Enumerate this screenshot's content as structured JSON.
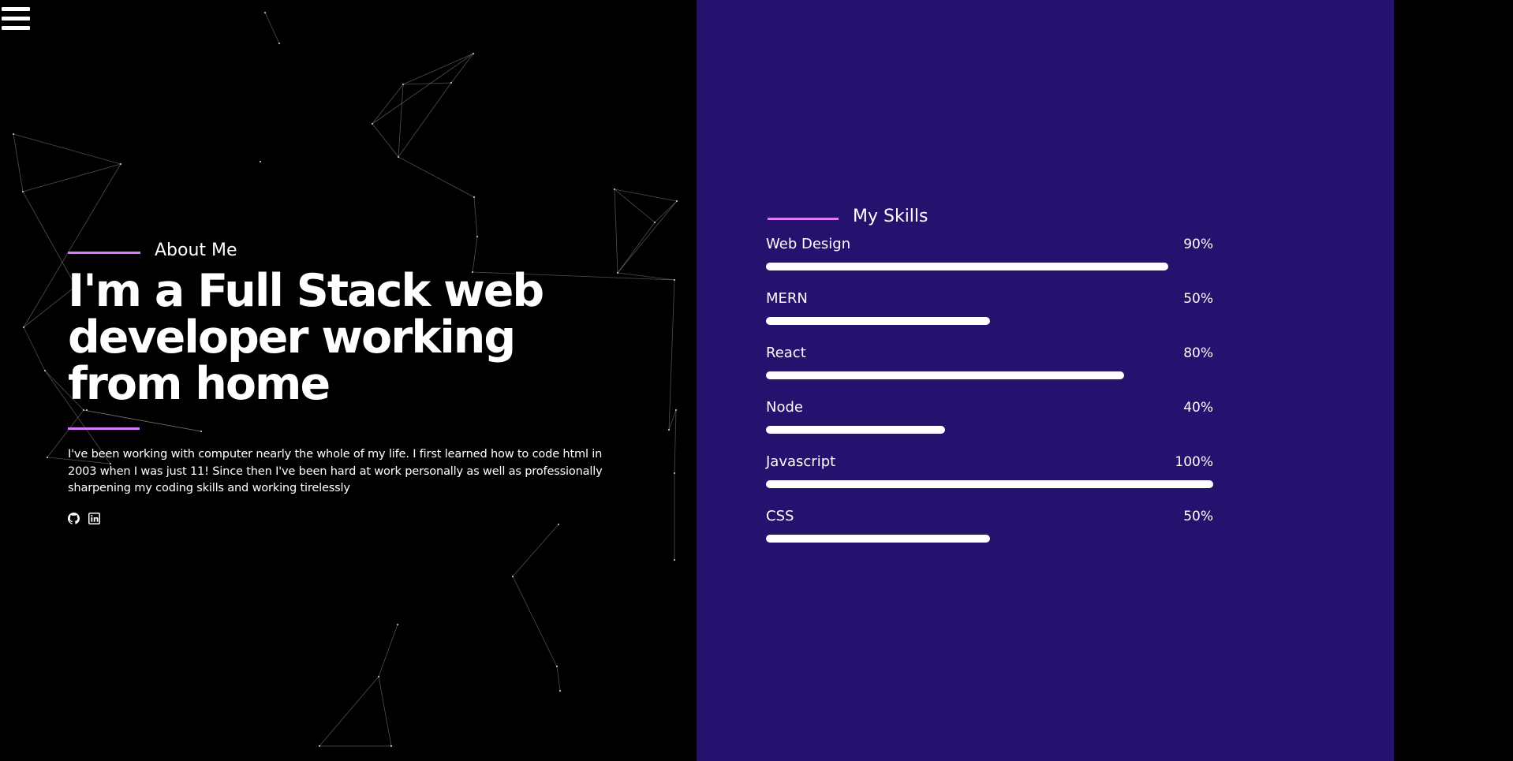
{
  "colors": {
    "background": "#000000",
    "skills_panel": "#24126e",
    "accent": "#e078ff",
    "text": "#ffffff",
    "network_lines": "#8f8f8f"
  },
  "menu": {
    "icon": "hamburger-menu-icon"
  },
  "about": {
    "heading": "About Me",
    "headline": "I'm a Full Stack web developer working from home",
    "bio": "I've been working with computer nearly the whole of my life. I first learned how to code html in 2003 when I was just 11! Since then I've been hard at work personally as well as professionally sharpening my coding skills and working tirelessly",
    "social": [
      {
        "icon": "github-icon"
      },
      {
        "icon": "linkedin-icon"
      }
    ]
  },
  "skills": {
    "heading": "My Skills",
    "items": [
      {
        "name": "Web Design",
        "percent_label": "90%",
        "level": 0.9
      },
      {
        "name": "MERN",
        "percent_label": "50%",
        "level": 0.5
      },
      {
        "name": "React",
        "percent_label": "80%",
        "level": 0.8
      },
      {
        "name": "Node",
        "percent_label": "40%",
        "level": 0.4
      },
      {
        "name": "Javascript",
        "percent_label": "100%",
        "level": 1.0
      },
      {
        "name": "CSS",
        "percent_label": "50%",
        "level": 0.5
      }
    ]
  }
}
